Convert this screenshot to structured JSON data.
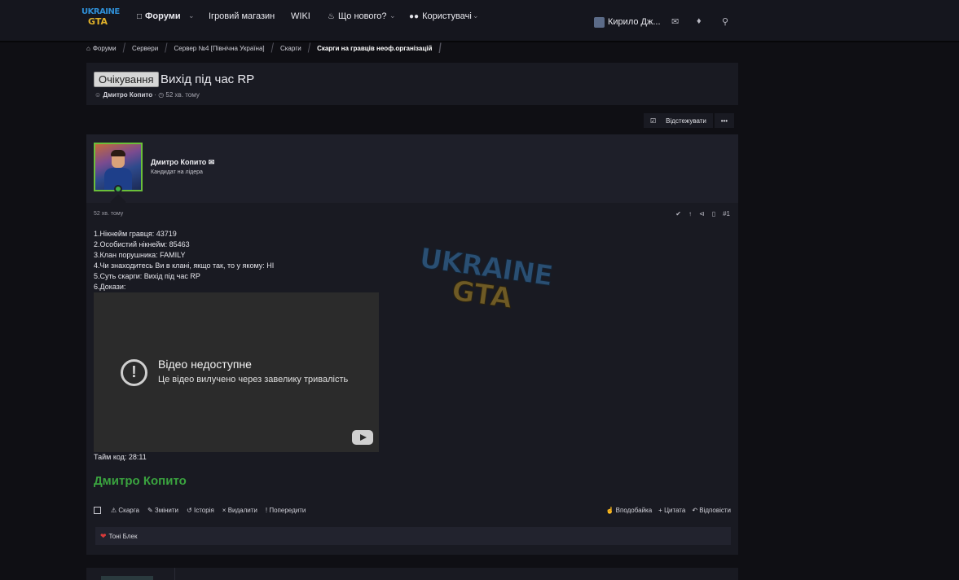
{
  "nav": {
    "logo": {
      "line1": "UKRAINE",
      "line2": "GTA"
    },
    "items": [
      {
        "label": "Форуми",
        "icon": "chat-icon"
      },
      {
        "label": "Ігровий магазин"
      },
      {
        "label": "WIKI"
      },
      {
        "label": "Що нового?",
        "icon": "bell-icon"
      },
      {
        "label": "Користувачі",
        "icon": "users-icon"
      }
    ],
    "user_name": "Кирило Дж...",
    "icons": [
      "envelope-icon",
      "bell-icon",
      "search-icon"
    ]
  },
  "breadcrumbs": [
    "Форуми",
    "Сервери",
    "Сервер №4 [Північна Україна]",
    "Скарги",
    "Скарги на гравців неоф.організацій"
  ],
  "thread": {
    "status_badge": "Очікування",
    "title": "Вихід під час RP",
    "author": "Дмитро Копито",
    "time": "52 хв. тому"
  },
  "actions": {
    "watch_label": "Відстежувати",
    "more_label": "•••"
  },
  "post": {
    "author": "Дмитро Копито",
    "author_title": "Кандидат на лідера",
    "time": "52 хв. тому",
    "number": "#1",
    "lines": [
      "1.Нікнейм гравця: 43719",
      "2.Особистий нікнейм: 85463",
      "3.Клан порушника: FAMILY",
      "4.Чи знаходитесь Ви в клані, якщо так, то у якому: НІ",
      "5.Суть скарги: Вихід під час RP",
      "6.Докази:"
    ],
    "video": {
      "title": "Відео недоступне",
      "subtitle": "Це відео вилучено через завелику тривалість"
    },
    "timecode": "Тайм код: 28:11",
    "signature": "Дмитро Копито",
    "footer_left": [
      "Скарга",
      "Змінити",
      "Історія",
      "Видалити",
      "Попередити"
    ],
    "footer_right": [
      "Вподобайка",
      "Цитата",
      "Відповісти"
    ],
    "reactions": "Тоні Блек"
  },
  "watermark": {
    "line1": "UKRAINE",
    "line2": "GTA"
  },
  "colors": {
    "accent_green": "#3aa33f",
    "background": "#0f0f14",
    "panel": "#191a22"
  }
}
